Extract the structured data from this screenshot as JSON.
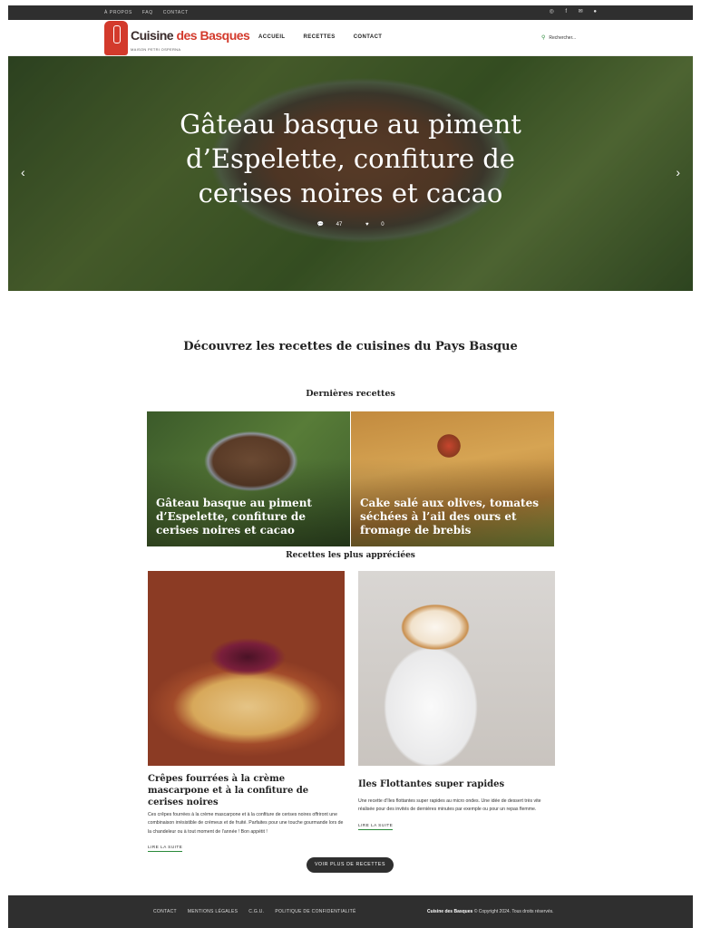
{
  "topbar": {
    "links": [
      "À PROPOS",
      "FAQ",
      "CONTACT"
    ],
    "social_icons": [
      "instagram-icon",
      "facebook-icon",
      "email-icon",
      "pinterest-icon"
    ]
  },
  "header": {
    "logo_text_a": "Cuisine",
    "logo_text_b": "des Basques",
    "logo_sub": "MAISON PETRI OSPERNA",
    "nav": [
      "ACCUEIL",
      "RECETTES",
      "CONTACT"
    ],
    "search_placeholder": "Rechercher..."
  },
  "hero": {
    "title": "Gâteau basque au piment d’Espelette, confiture de cerises noires et cacao",
    "comments": "47",
    "likes": "0"
  },
  "sections": {
    "intro": "Découvrez les recettes de cuisines du Pays Basque",
    "latest": "Dernières recettes",
    "popular": "Recettes les plus appréciées"
  },
  "latest": [
    {
      "title": "Gâteau basque au piment d’Espelette, confiture de cerises noires et cacao"
    },
    {
      "title": "Cake salé aux olives, tomates séchées à l’ail des ours et fromage de brebis"
    }
  ],
  "popular": [
    {
      "title": "Crêpes fourrées à la crème mascarpone et à la confiture de cerises noires",
      "excerpt": "Ces crêpes fourrées à la crème mascarpone et à la confiture de cerises noires offriront une combinaison irrésistible de crémeux et de fruité. Parfaites pour une touche gourmande lors de la chandeleur ou à tout moment de l’année ! Bon appétit !",
      "more": "LIRE LA SUITE"
    },
    {
      "title": "Iles Flottantes super rapides",
      "excerpt": "Une recette d’îles flottantes super rapides au micro ondes. Une idée de dessert très vite réalisée pour des invités de dernières minutes par exemple ou pour un repas flemme.",
      "more": "LIRE LA SUITE"
    }
  ],
  "more_button": "VOIR PLUS DE RECETTES",
  "footer": {
    "links": [
      "CONTACT",
      "MENTIONS LÉGALES",
      "C.G.U.",
      "POLITIQUE DE CONFIDENTIALITÉ"
    ],
    "brand": "Cuisine des Basques",
    "copyright": "© Copyright 2024. Tous droits réservés."
  },
  "colors": {
    "brand_red": "#d33a2c",
    "accent_green": "#2a8a3a",
    "dark_bar": "#2f2f2f"
  }
}
